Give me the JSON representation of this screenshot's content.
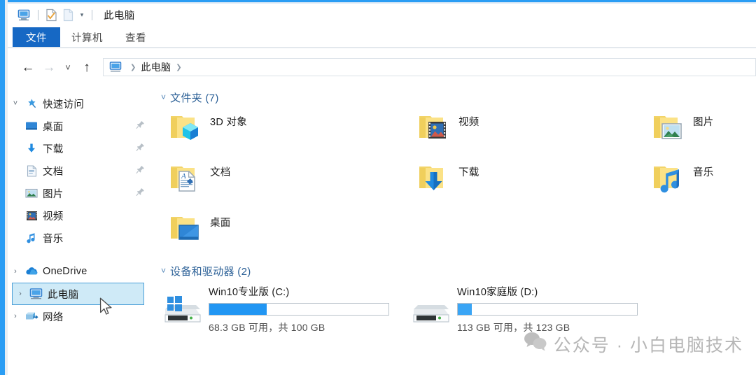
{
  "window": {
    "title": "此电脑",
    "accent_color": "#2a9df4",
    "quick_access_toolbar": [
      {
        "name": "this-pc-icon",
        "label": "此电脑"
      },
      {
        "name": "properties-icon",
        "label": "属性"
      },
      {
        "name": "new-folder-icon",
        "label": "新建文件夹"
      },
      {
        "name": "customize-dropdown-icon",
        "label": "自定义快速访问工具栏"
      }
    ]
  },
  "ribbon": {
    "tabs": [
      {
        "label": "文件",
        "active": true
      },
      {
        "label": "计算机",
        "active": false
      },
      {
        "label": "查看",
        "active": false
      }
    ],
    "active_tab_color": "#1668c4"
  },
  "navbar": {
    "back": "后退",
    "forward": "前进",
    "recent": "最近浏览的位置",
    "up": "上移一级",
    "breadcrumb": [
      "此电脑"
    ],
    "breadcrumb_icon": "this-pc-icon"
  },
  "sidebar": {
    "groups": [
      {
        "label": "快速访问",
        "icon": "pin-star-icon",
        "expanded": true,
        "chevron": "˅",
        "children": [
          {
            "label": "桌面",
            "icon": "desktop-icon",
            "pinned": true
          },
          {
            "label": "下载",
            "icon": "downloads-arrow-icon",
            "pinned": true
          },
          {
            "label": "文档",
            "icon": "documents-icon",
            "pinned": true
          },
          {
            "label": "图片",
            "icon": "pictures-icon",
            "pinned": true
          },
          {
            "label": "视频",
            "icon": "videos-icon",
            "pinned": false
          },
          {
            "label": "音乐",
            "icon": "music-note-icon",
            "pinned": false
          }
        ]
      }
    ],
    "items": [
      {
        "label": "OneDrive",
        "icon": "onedrive-cloud-icon",
        "chevron": "›",
        "selected": false
      },
      {
        "label": "此电脑",
        "icon": "this-pc-icon",
        "chevron": "›",
        "selected": true
      },
      {
        "label": "网络",
        "icon": "network-icon",
        "chevron": "›",
        "selected": false
      }
    ],
    "selection_fill": "#cfeaf7",
    "selection_border": "#4a9fd8"
  },
  "content": {
    "folders_group": {
      "title": "文件夹 (7)",
      "chevron": "˅",
      "items": [
        {
          "label": "3D 对象",
          "icon": "folder-3d-objects-icon"
        },
        {
          "label": "视频",
          "icon": "folder-videos-icon"
        },
        {
          "label": "图片",
          "icon": "folder-pictures-icon"
        },
        {
          "label": "文档",
          "icon": "folder-documents-icon"
        },
        {
          "label": "下载",
          "icon": "folder-downloads-icon"
        },
        {
          "label": "音乐",
          "icon": "folder-music-icon"
        },
        {
          "label": "桌面",
          "icon": "folder-desktop-icon"
        }
      ]
    },
    "drives_group": {
      "title": "设备和驱动器 (2)",
      "chevron": "˅",
      "items": [
        {
          "label": "Win10专业版 (C:)",
          "icon": "drive-windows-icon",
          "capacity_text": "68.3 GB 可用，共 100 GB",
          "free_gb": 68.3,
          "total_gb": 100,
          "used_percent": 32,
          "bar_color": "#2196f3"
        },
        {
          "label": "Win10家庭版 (D:)",
          "icon": "drive-icon",
          "capacity_text": "113 GB 可用，共 123 GB",
          "free_gb": 113,
          "total_gb": 123,
          "used_percent": 8,
          "bar_color": "#3aa5f5"
        }
      ]
    }
  },
  "watermark": {
    "text": "公众号 · 小白电脑技术",
    "icon": "wechat-icon",
    "color": "#b6b6b6"
  }
}
